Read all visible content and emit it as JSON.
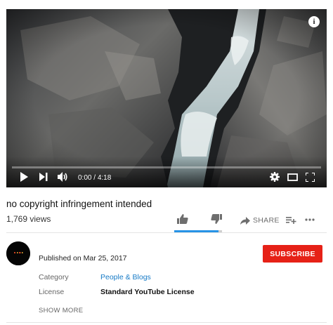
{
  "player": {
    "current_time": "0:00",
    "duration": "4:18",
    "time_separator": " / ",
    "progress": 0.0,
    "info_glyph": "i"
  },
  "video": {
    "title": "no copyright infringement intended",
    "views": "1,769 views",
    "share_label": "SHARE",
    "like_ratio": 0.92
  },
  "channel": {
    "published": "Published on Mar 25, 2017",
    "subscribe_label": "SUBSCRIBE"
  },
  "metadata": {
    "category_label": "Category",
    "category_value": "People & Blogs",
    "license_label": "License",
    "license_value": "Standard YouTube License",
    "show_more": "SHOW MORE"
  },
  "icons": {
    "play": "play-icon",
    "next": "next-icon",
    "volume": "volume-icon",
    "settings": "gear-icon",
    "theater": "theater-mode-icon",
    "fullscreen": "fullscreen-icon",
    "like": "thumbs-up-icon",
    "dislike": "thumbs-down-icon",
    "share": "share-arrow-icon",
    "add": "add-to-playlist-icon",
    "more": "more-dots-icon",
    "info": "info-icon"
  },
  "colors": {
    "progress": "#ff0000",
    "subscribe": "#e62117",
    "link": "#167ac6",
    "like_bar": "#2793e6"
  }
}
